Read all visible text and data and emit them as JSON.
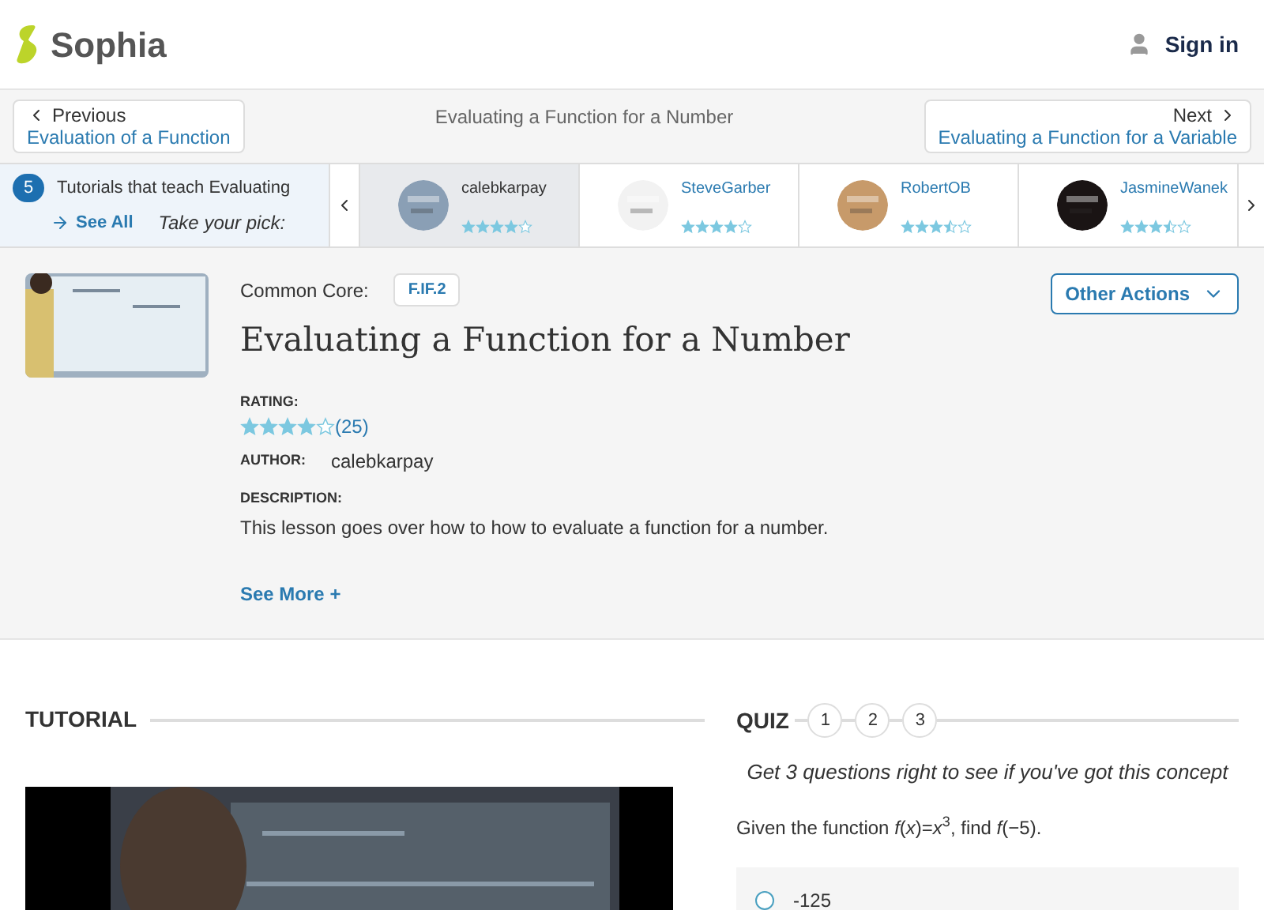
{
  "header": {
    "logo": "Sophia",
    "sign_in": "Sign in"
  },
  "nav": {
    "previous": {
      "label": "Previous",
      "title": "Evaluation of a Function"
    },
    "current": "Evaluating a Function for a Number",
    "next": {
      "label": "Next",
      "title": "Evaluating a Function for a Variable"
    }
  },
  "tutorials": {
    "count": "5",
    "text": "Tutorials that teach Evaluating",
    "see_all": "See All",
    "pick": "Take your pick:",
    "items": [
      {
        "author": "calebkarpay",
        "stars": 4,
        "selected": true
      },
      {
        "author": "SteveGarber",
        "stars": 4,
        "selected": false
      },
      {
        "author": "RobertOB",
        "stars": 3.5,
        "selected": false
      },
      {
        "author": "JasmineWanek",
        "stars": 3.5,
        "selected": false
      }
    ]
  },
  "lesson": {
    "common_core_label": "Common Core:",
    "standard": "F.IF.2",
    "title": "Evaluating a Function for a Number",
    "other_actions": "Other Actions",
    "rating_label": "RATING:",
    "stars": 4,
    "rating_count": "(25)",
    "author_label": "AUTHOR:",
    "author": "calebkarpay",
    "description_label": "DESCRIPTION:",
    "description": "This lesson goes over how to how to evaluate a function for a number.",
    "see_more": "See More +"
  },
  "tutorial_section": {
    "heading": "TUTORIAL"
  },
  "quiz": {
    "heading": "QUIZ",
    "steps": [
      "1",
      "2",
      "3"
    ],
    "prompt": "Get 3 questions right to see if you've got this concept",
    "question": "Given the function *f*(*x*)=*x*$^{3}$, find *f*(−5).",
    "options": [
      {
        "text": "-125",
        "selected": false
      }
    ]
  }
}
